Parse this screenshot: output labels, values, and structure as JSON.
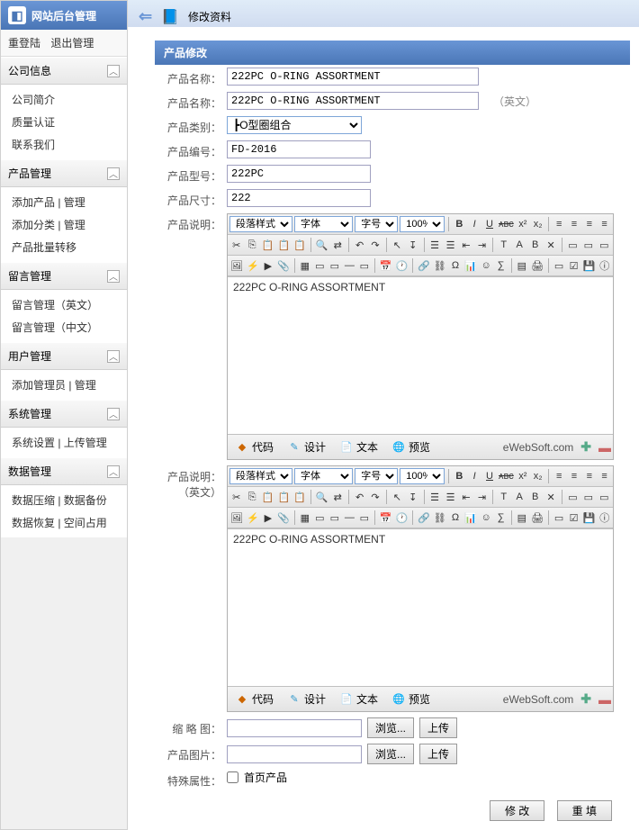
{
  "sidebar": {
    "title": "网站后台管理",
    "top_actions": {
      "relogin": "重登陆",
      "logout": "退出管理"
    },
    "groups": [
      {
        "title": "公司信息",
        "items": [
          "公司简介",
          "质量认证",
          "联系我们"
        ]
      },
      {
        "title": "产品管理",
        "items": [
          "添加产品 | 管理",
          "添加分类 | 管理",
          "产品批量转移"
        ]
      },
      {
        "title": "留言管理",
        "items": [
          "留言管理（英文）",
          "留言管理（中文）"
        ]
      },
      {
        "title": "用户管理",
        "items": [
          "添加管理员 | 管理"
        ]
      },
      {
        "title": "系统管理",
        "items": [
          "系统设置 | 上传管理"
        ]
      },
      {
        "title": "数据管理",
        "items": [
          "数据压缩 | 数据备份",
          "数据恢复 | 空间占用"
        ]
      }
    ]
  },
  "breadcrumb": {
    "title": "修改资料"
  },
  "panel": {
    "title": "产品修改"
  },
  "form": {
    "labels": {
      "name": "产品名称：",
      "name_en": "产品名称：",
      "name_en_hint": "（英文）",
      "category": "产品类别：",
      "code": "产品编号：",
      "model": "产品型号：",
      "size": "产品尺寸：",
      "desc": "产品说明：",
      "desc_en": "产品说明：",
      "desc_en_sub": "（英文）",
      "thumb": "缩 略 图：",
      "images": "产品图片：",
      "special": "特殊属性：",
      "homepage": "首页产品"
    },
    "values": {
      "name": "222PC O-RING ASSORTMENT",
      "name_en": "222PC O-RING ASSORTMENT",
      "category": "┣O型圈组合",
      "code": "FD-2016",
      "model": "222PC",
      "size": "222",
      "desc": "222PC O-RING ASSORTMENT",
      "desc_en": "222PC O-RING ASSORTMENT"
    },
    "buttons": {
      "browse": "浏览...",
      "upload": "上传",
      "submit": "修 改",
      "reset": "重 填"
    }
  },
  "editor": {
    "dropdowns": {
      "para": "段落样式",
      "font": "字体",
      "size": "字号",
      "zoom": "100%"
    },
    "foot": {
      "code": "代码",
      "design": "设计",
      "text": "文本",
      "preview": "预览",
      "brand": "eWebSoft.com"
    }
  }
}
